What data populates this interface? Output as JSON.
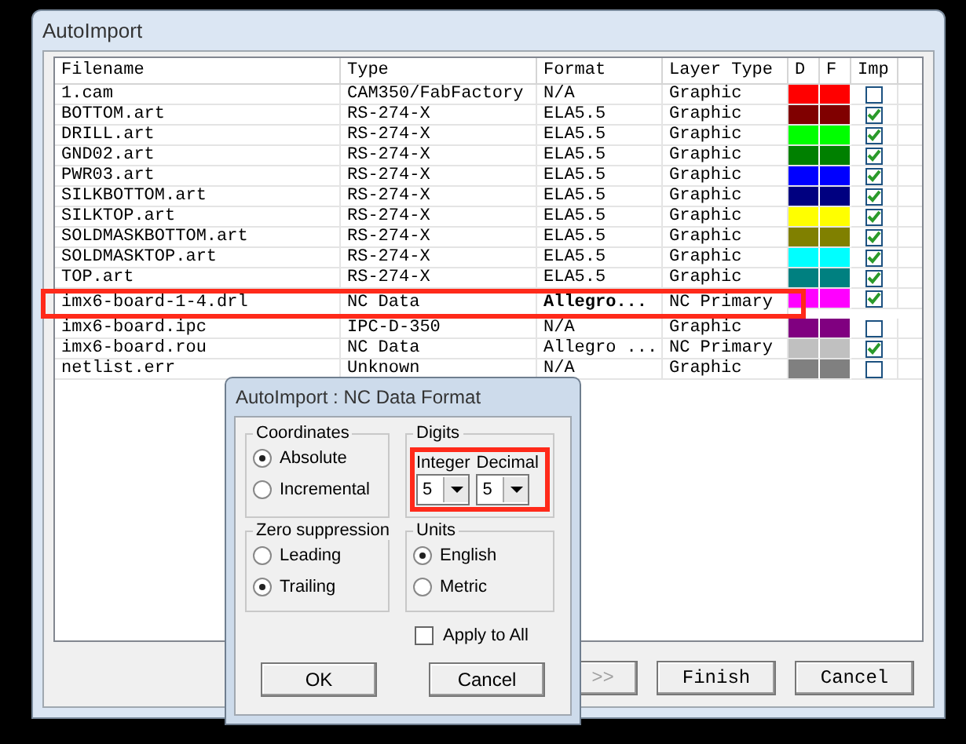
{
  "window": {
    "title": "AutoImport"
  },
  "table": {
    "columns": [
      "Filename",
      "Type",
      "Format",
      "Layer Type",
      "D",
      "F",
      "Imp"
    ],
    "rows": [
      {
        "filename": "1.cam",
        "type": "CAM350/FabFactory",
        "format": "N/A",
        "layer_type": "Graphic",
        "color": "#ff0000",
        "imp": false,
        "selected": false
      },
      {
        "filename": "BOTTOM.art",
        "type": "RS-274-X",
        "format": "ELA5.5",
        "layer_type": "Graphic",
        "color": "#800000",
        "imp": true,
        "selected": false
      },
      {
        "filename": "DRILL.art",
        "type": "RS-274-X",
        "format": "ELA5.5",
        "layer_type": "Graphic",
        "color": "#00ff00",
        "imp": true,
        "selected": false
      },
      {
        "filename": "GND02.art",
        "type": "RS-274-X",
        "format": "ELA5.5",
        "layer_type": "Graphic",
        "color": "#008000",
        "imp": true,
        "selected": false
      },
      {
        "filename": "PWR03.art",
        "type": "RS-274-X",
        "format": "ELA5.5",
        "layer_type": "Graphic",
        "color": "#0000ff",
        "imp": true,
        "selected": false
      },
      {
        "filename": "SILKBOTTOM.art",
        "type": "RS-274-X",
        "format": "ELA5.5",
        "layer_type": "Graphic",
        "color": "#000080",
        "imp": true,
        "selected": false
      },
      {
        "filename": "SILKTOP.art",
        "type": "RS-274-X",
        "format": "ELA5.5",
        "layer_type": "Graphic",
        "color": "#ffff00",
        "imp": true,
        "selected": false
      },
      {
        "filename": "SOLDMASKBOTTOM.art",
        "type": "RS-274-X",
        "format": "ELA5.5",
        "layer_type": "Graphic",
        "color": "#808000",
        "imp": true,
        "selected": false
      },
      {
        "filename": "SOLDMASKTOP.art",
        "type": "RS-274-X",
        "format": "ELA5.5",
        "layer_type": "Graphic",
        "color": "#00ffff",
        "imp": true,
        "selected": false
      },
      {
        "filename": "TOP.art",
        "type": "RS-274-X",
        "format": "ELA5.5",
        "layer_type": "Graphic",
        "color": "#008080",
        "imp": true,
        "selected": false
      },
      {
        "filename": "imx6-board-1-4.drl",
        "type": "NC Data",
        "format": "Allegro...",
        "layer_type": "NC Primary",
        "color": "#ff00ff",
        "imp": true,
        "selected": true
      },
      {
        "filename": "imx6-board.ipc",
        "type": "IPC-D-350",
        "format": "N/A",
        "layer_type": "Graphic",
        "color": "#800080",
        "imp": false,
        "selected": false
      },
      {
        "filename": "imx6-board.rou",
        "type": "NC Data",
        "format": "Allegro ...",
        "layer_type": "NC Primary",
        "color": "#c0c0c0",
        "imp": true,
        "selected": false
      },
      {
        "filename": "netlist.err",
        "type": "Unknown",
        "format": "N/A",
        "layer_type": "Graphic",
        "color": "#808080",
        "imp": false,
        "selected": false
      }
    ]
  },
  "buttons": [
    {
      "label": ">>",
      "disabled": true
    },
    {
      "label": "Finish",
      "disabled": false
    },
    {
      "label": "Cancel",
      "disabled": false
    }
  ],
  "dialog": {
    "title": "AutoImport : NC Data Format",
    "coordinates": {
      "label": "Coordinates",
      "options": [
        {
          "label": "Absolute",
          "selected": true
        },
        {
          "label": "Incremental",
          "selected": false
        }
      ]
    },
    "digits": {
      "label": "Digits",
      "fields": [
        {
          "label": "Integer",
          "value": "5"
        },
        {
          "label": "Decimal",
          "value": "5"
        }
      ]
    },
    "zero_suppression": {
      "label": "Zero suppression",
      "options": [
        {
          "label": "Leading",
          "selected": false
        },
        {
          "label": "Trailing",
          "selected": true
        }
      ]
    },
    "units": {
      "label": "Units",
      "options": [
        {
          "label": "English",
          "selected": true
        },
        {
          "label": "Metric",
          "selected": false
        }
      ]
    },
    "apply_to_all": {
      "label": "Apply to All",
      "checked": false
    },
    "buttons": [
      "OK",
      "Cancel"
    ]
  }
}
